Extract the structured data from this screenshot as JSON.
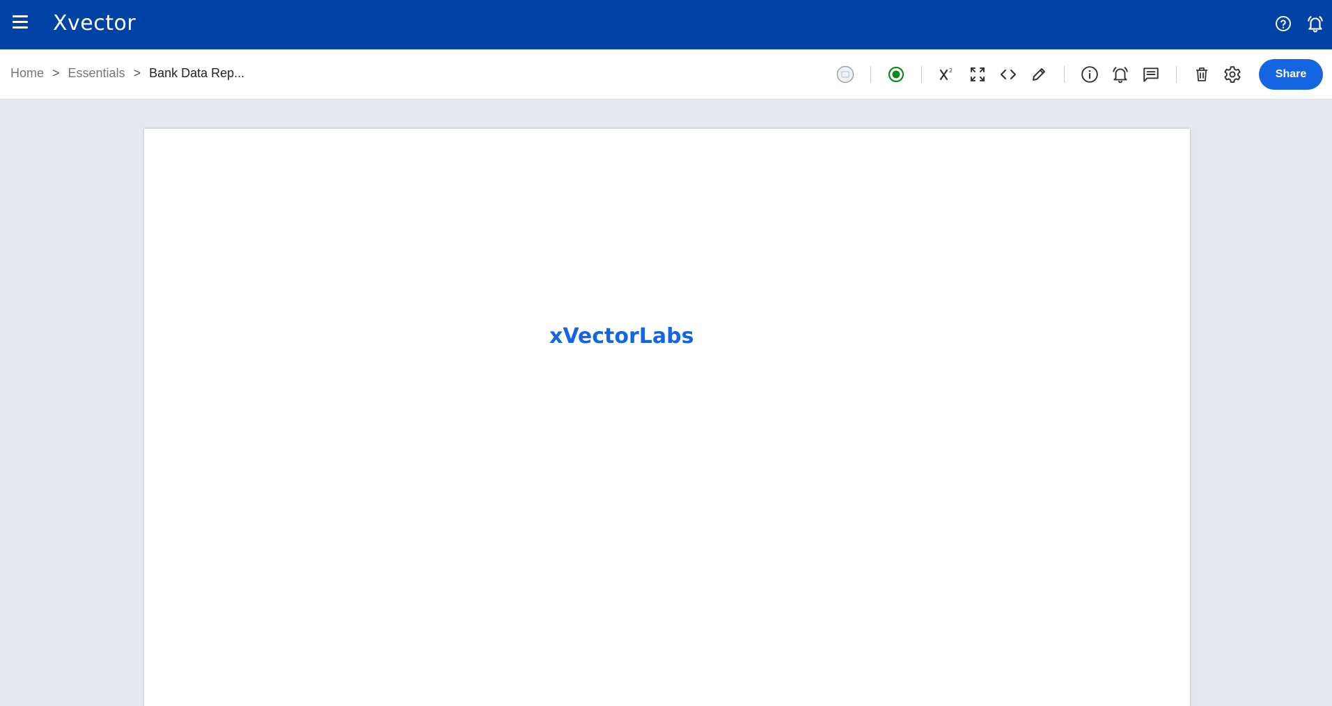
{
  "app": {
    "logo_text": "Xvector",
    "brand_color": "#0043a4",
    "accent_color": "#1565e3"
  },
  "header": {
    "menu_icon": "hamburger-menu-icon",
    "help_icon": "help-circle-icon",
    "alerts_icon": "bell-alert-icon"
  },
  "breadcrumb": {
    "items": [
      "Home",
      "Essentials",
      "Bank Data Rep..."
    ],
    "separator": ">"
  },
  "toolbar": {
    "icons": [
      "avatar-placeholder-icon",
      "status-live-icon",
      "superscript-icon",
      "fullscreen-icon",
      "code-icon",
      "edit-pencil-icon",
      "info-icon",
      "alert-bell-icon",
      "comments-icon",
      "delete-trash-icon",
      "settings-gear-icon"
    ],
    "share_label": "Share",
    "status_color": "#0a8a1f"
  },
  "document": {
    "title": "xVectorLabs"
  }
}
